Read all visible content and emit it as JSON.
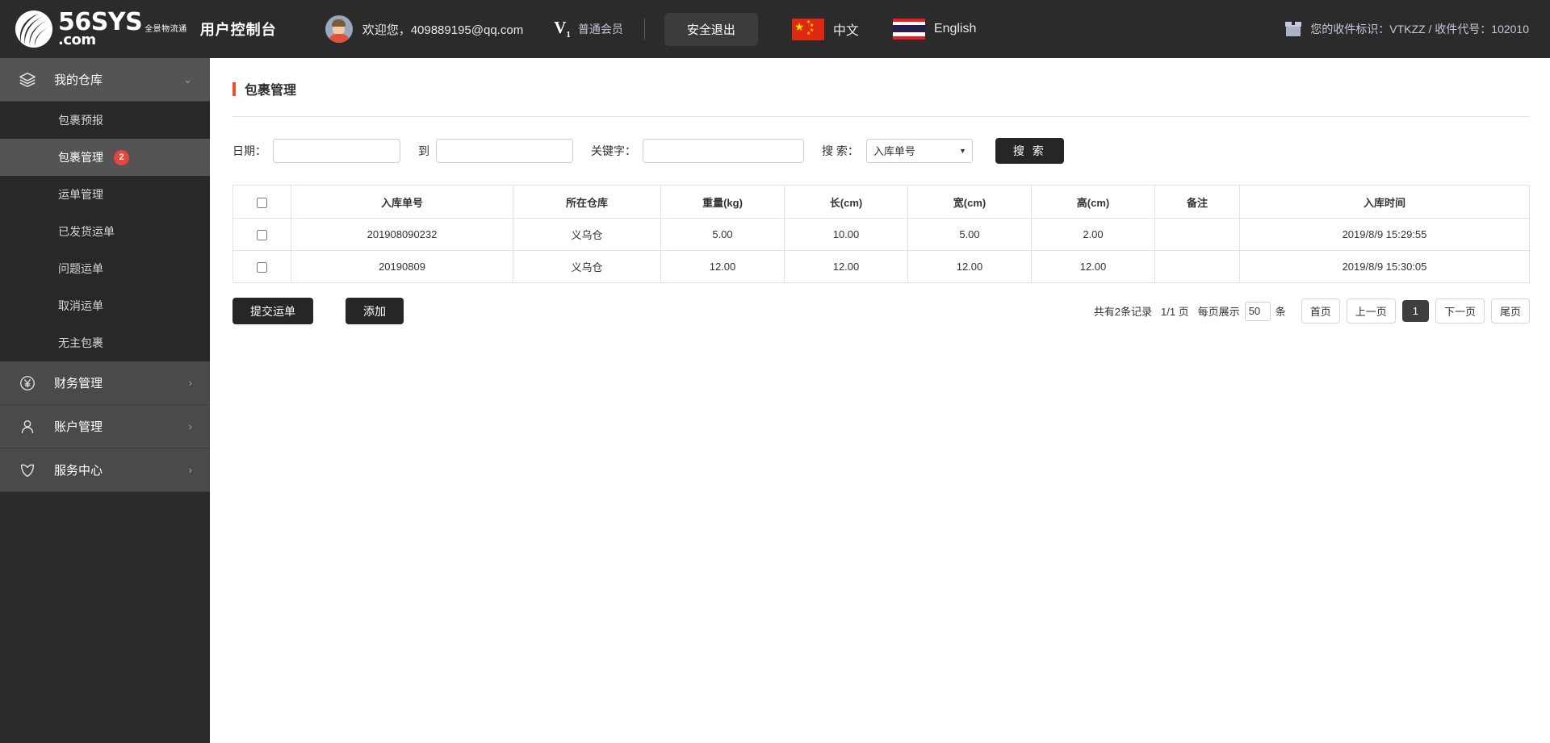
{
  "header": {
    "brand_name": "56SYS",
    "brand_domain": ".com",
    "brand_cn_line1": "全景物流通",
    "console_title": "用户控制台",
    "welcome": "欢迎您，409889195@qq.com",
    "vip_badge": "V",
    "vip_badge_sub": "1",
    "vip_label": "普通会员",
    "logout_label": "安全退出",
    "lang_cn": "中文",
    "lang_en": "English",
    "receiver_info": "您的收件标识：VTKZZ / 收件代号：102010"
  },
  "sidebar": {
    "groups": [
      {
        "label": "我的仓库",
        "icon": "layers-icon",
        "expanded": true,
        "items": [
          {
            "label": "包裹预报",
            "badge": "",
            "active": false
          },
          {
            "label": "包裹管理",
            "badge": "2",
            "active": true
          },
          {
            "label": "运单管理",
            "badge": "",
            "active": false
          },
          {
            "label": "已发货运单",
            "badge": "",
            "active": false
          },
          {
            "label": "问题运单",
            "badge": "",
            "active": false
          },
          {
            "label": "取消运单",
            "badge": "",
            "active": false
          },
          {
            "label": "无主包裹",
            "badge": "",
            "active": false
          }
        ]
      },
      {
        "label": "财务管理",
        "icon": "yuan-circle-icon",
        "expanded": false,
        "items": []
      },
      {
        "label": "账户管理",
        "icon": "user-icon",
        "expanded": false,
        "items": []
      },
      {
        "label": "服务中心",
        "icon": "shield-icon",
        "expanded": false,
        "items": []
      }
    ]
  },
  "main": {
    "page_title": "包裹管理",
    "search": {
      "date_label": "日期：",
      "date_from_value": "",
      "date_to_separator": "到",
      "date_to_value": "",
      "keyword_label": "关键字：",
      "keyword_value": "",
      "search_by_label": "搜 索：",
      "search_by_selected": "入库单号",
      "search_by_options": [
        "入库单号"
      ],
      "search_button": "搜 索"
    },
    "table": {
      "headers": [
        "",
        "入库单号",
        "所在仓库",
        "重量(kg)",
        "长(cm)",
        "宽(cm)",
        "高(cm)",
        "备注",
        "入库时间"
      ],
      "rows": [
        {
          "checked": false,
          "order_no": "201908090232",
          "warehouse": "义乌仓",
          "weight": "5.00",
          "length": "10.00",
          "width": "5.00",
          "height": "2.00",
          "note": "",
          "time": "2019/8/9 15:29:55"
        },
        {
          "checked": false,
          "order_no": "20190809",
          "warehouse": "义乌仓",
          "weight": "12.00",
          "length": "12.00",
          "width": "12.00",
          "height": "12.00",
          "note": "",
          "time": "2019/8/9 15:30:05"
        }
      ]
    },
    "actions": {
      "submit_label": "提交运单",
      "add_label": "添加"
    },
    "pagination": {
      "total_text": "共有2条记录",
      "page_text": "1/1 页",
      "per_page_label": "每页展示",
      "per_page_value": "50",
      "unit": "条",
      "first": "首页",
      "prev": "上一页",
      "current": "1",
      "next": "下一页",
      "last": "尾页"
    }
  },
  "colors": {
    "header_bg": "#2b2b2b",
    "sidebar_bg": "#2b2b2b",
    "accent_orange": "#e8512f",
    "badge_red": "#e8453c",
    "active_item": "#545454"
  }
}
